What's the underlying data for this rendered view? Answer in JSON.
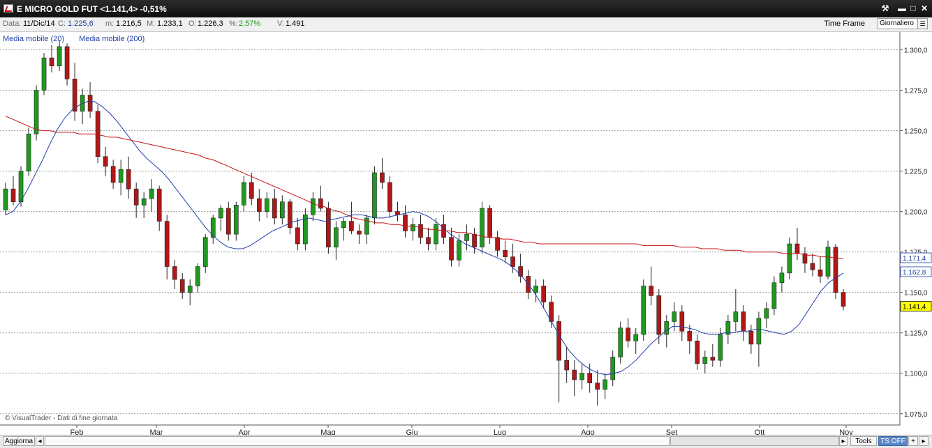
{
  "window": {
    "title": "E MICRO GOLD FUT <1.141,4> -0,51%",
    "buttons": {
      "tools": "⚒",
      "minimize": "▬",
      "maximize": "□",
      "close": "✕"
    }
  },
  "infobar": {
    "date_label": "Data:",
    "date_value": "11/Dic/14",
    "close_label": "C:",
    "close_value": "1.225,6",
    "min_label": "m:",
    "min_value": "1.216,5",
    "max_label": "M:",
    "max_value": "1.233,1",
    "open_label": "O:",
    "open_value": "1.226,3",
    "pct_label": "%:",
    "pct_value": "2,57%",
    "vol_label": "V:",
    "vol_value": "1.491",
    "timeframe_label": "Time Frame",
    "timeframe_value": "Giornaliero"
  },
  "legend": {
    "ma20": "Media mobile (20)",
    "ma200": "Media mobile (200)"
  },
  "watermark": "© VisualTrader - Dati di fine giornata",
  "bottom": {
    "refresh": "Aggiorna",
    "tools": "Tools",
    "ts_off": "TS OFF",
    "plus": "+",
    "arrow": "▸"
  },
  "colors": {
    "up": "#1f9a1f",
    "down": "#b01818",
    "ma20": "#1f3fa8",
    "ma200": "#c81414",
    "last_price_bg": "#ffff00"
  },
  "chart_data": {
    "type": "candlestick",
    "x_tick_labels": [
      "Feb",
      "Mar",
      "Apr",
      "Mag",
      "Giu",
      "Lug",
      "Ago",
      "Set",
      "Ott",
      "Nov"
    ],
    "y_tick_labels": [
      "1.300,0",
      "1.275,0",
      "1.250,0",
      "1.225,0",
      "1.200,0",
      "1.175,0",
      "1.150,0",
      "1.125,0",
      "1.100,0",
      "1.075,0"
    ],
    "y_ticks": [
      1300,
      1275,
      1250,
      1225,
      1200,
      1175,
      1150,
      1125,
      1100,
      1075
    ],
    "ylim": [
      1068,
      1311
    ],
    "price_labels": [
      {
        "text": "1.171,4",
        "value": 1171.4,
        "style": "ma200"
      },
      {
        "text": "1.162,8",
        "value": 1162.8,
        "style": "ma20"
      },
      {
        "text": "1.141,4",
        "value": 1141.4,
        "style": "last"
      }
    ],
    "series_ma20": [
      1198,
      1200,
      1206,
      1214,
      1223,
      1232,
      1242,
      1251,
      1258,
      1263,
      1266,
      1268,
      1268,
      1265,
      1261,
      1256,
      1250,
      1244,
      1238,
      1233,
      1229,
      1225,
      1220,
      1214,
      1208,
      1202,
      1196,
      1190,
      1185,
      1181,
      1178,
      1177,
      1177,
      1179,
      1182,
      1185,
      1188,
      1190,
      1192,
      1194,
      1195,
      1196,
      1195,
      1194,
      1195,
      1196,
      1197,
      1198,
      1198,
      1197,
      1196,
      1196,
      1197,
      1198,
      1199,
      1200,
      1199,
      1197,
      1194,
      1190,
      1186,
      1183,
      1180,
      1178,
      1176,
      1174,
      1172,
      1170,
      1167,
      1163,
      1158,
      1152,
      1145,
      1137,
      1129,
      1121,
      1114,
      1109,
      1105,
      1102,
      1100,
      1099,
      1100,
      1101,
      1104,
      1108,
      1113,
      1118,
      1122,
      1126,
      1129,
      1129,
      1128,
      1127,
      1125,
      1124,
      1124,
      1125,
      1125,
      1126,
      1126,
      1127,
      1127,
      1126,
      1125,
      1124,
      1126,
      1130,
      1137,
      1144,
      1151,
      1156,
      1159,
      1162
    ],
    "series_ma200": [
      1259,
      1257,
      1255,
      1253,
      1251,
      1250,
      1250,
      1249,
      1249,
      1249,
      1248,
      1248,
      1248,
      1247,
      1246,
      1246,
      1245,
      1244,
      1243,
      1242,
      1241,
      1240,
      1239,
      1238,
      1237,
      1236,
      1235,
      1233,
      1232,
      1230,
      1228,
      1226,
      1224,
      1222,
      1220,
      1218,
      1216,
      1214,
      1212,
      1210,
      1208,
      1206,
      1204,
      1203,
      1201,
      1200,
      1198,
      1196,
      1195,
      1194,
      1193,
      1193,
      1192,
      1192,
      1191,
      1191,
      1190,
      1189,
      1189,
      1188,
      1188,
      1187,
      1187,
      1186,
      1185,
      1184,
      1184,
      1183,
      1183,
      1182,
      1181,
      1181,
      1180,
      1180,
      1180,
      1180,
      1180,
      1180,
      1180,
      1180,
      1180,
      1180,
      1180,
      1180,
      1180,
      1180,
      1179,
      1179,
      1179,
      1179,
      1179,
      1178,
      1178,
      1178,
      1177,
      1177,
      1177,
      1176,
      1176,
      1176,
      1175,
      1175,
      1175,
      1175,
      1175,
      1174,
      1174,
      1174,
      1173,
      1173,
      1172,
      1172,
      1171,
      1171
    ],
    "ohlc_step": 2,
    "candles": [
      [
        1201,
        1218,
        1198,
        1214
      ],
      [
        1214,
        1222,
        1204,
        1206
      ],
      [
        1206,
        1228,
        1203,
        1225
      ],
      [
        1225,
        1252,
        1222,
        1248
      ],
      [
        1248,
        1278,
        1244,
        1275
      ],
      [
        1275,
        1298,
        1272,
        1295
      ],
      [
        1295,
        1303,
        1286,
        1290
      ],
      [
        1290,
        1306,
        1287,
        1302
      ],
      [
        1302,
        1304,
        1278,
        1282
      ],
      [
        1282,
        1292,
        1256,
        1262
      ],
      [
        1262,
        1276,
        1254,
        1272
      ],
      [
        1272,
        1280,
        1258,
        1262
      ],
      [
        1262,
        1266,
        1230,
        1234
      ],
      [
        1234,
        1240,
        1222,
        1228
      ],
      [
        1228,
        1232,
        1214,
        1218
      ],
      [
        1218,
        1232,
        1210,
        1226
      ],
      [
        1226,
        1234,
        1208,
        1214
      ],
      [
        1214,
        1218,
        1196,
        1204
      ],
      [
        1204,
        1212,
        1196,
        1208
      ],
      [
        1208,
        1220,
        1200,
        1214
      ],
      [
        1214,
        1216,
        1188,
        1194
      ],
      [
        1194,
        1198,
        1158,
        1166
      ],
      [
        1166,
        1170,
        1152,
        1158
      ],
      [
        1158,
        1162,
        1146,
        1150
      ],
      [
        1150,
        1158,
        1142,
        1154
      ],
      [
        1154,
        1168,
        1150,
        1166
      ],
      [
        1166,
        1186,
        1162,
        1184
      ],
      [
        1184,
        1198,
        1180,
        1196
      ],
      [
        1196,
        1204,
        1188,
        1202
      ],
      [
        1202,
        1206,
        1182,
        1186
      ],
      [
        1186,
        1206,
        1182,
        1204
      ],
      [
        1204,
        1222,
        1200,
        1218
      ],
      [
        1218,
        1224,
        1204,
        1208
      ],
      [
        1208,
        1214,
        1194,
        1200
      ],
      [
        1200,
        1212,
        1196,
        1208
      ],
      [
        1208,
        1214,
        1192,
        1196
      ],
      [
        1196,
        1210,
        1192,
        1206
      ],
      [
        1206,
        1208,
        1186,
        1190
      ],
      [
        1190,
        1196,
        1176,
        1180
      ],
      [
        1180,
        1202,
        1176,
        1198
      ],
      [
        1198,
        1212,
        1194,
        1208
      ],
      [
        1208,
        1216,
        1200,
        1202
      ],
      [
        1202,
        1206,
        1174,
        1178
      ],
      [
        1178,
        1194,
        1170,
        1190
      ],
      [
        1190,
        1196,
        1182,
        1194
      ],
      [
        1194,
        1206,
        1186,
        1188
      ],
      [
        1188,
        1192,
        1180,
        1186
      ],
      [
        1186,
        1198,
        1180,
        1196
      ],
      [
        1196,
        1228,
        1192,
        1224
      ],
      [
        1224,
        1233,
        1214,
        1218
      ],
      [
        1218,
        1222,
        1196,
        1200
      ],
      [
        1200,
        1206,
        1194,
        1198
      ],
      [
        1198,
        1204,
        1184,
        1188
      ],
      [
        1188,
        1196,
        1182,
        1192
      ],
      [
        1192,
        1198,
        1180,
        1184
      ],
      [
        1184,
        1190,
        1176,
        1180
      ],
      [
        1180,
        1196,
        1176,
        1192
      ],
      [
        1192,
        1198,
        1180,
        1184
      ],
      [
        1184,
        1190,
        1166,
        1170
      ],
      [
        1170,
        1186,
        1166,
        1182
      ],
      [
        1182,
        1192,
        1176,
        1186
      ],
      [
        1186,
        1190,
        1174,
        1178
      ],
      [
        1178,
        1206,
        1174,
        1202
      ],
      [
        1202,
        1204,
        1180,
        1184
      ],
      [
        1184,
        1188,
        1172,
        1176
      ],
      [
        1176,
        1182,
        1168,
        1172
      ],
      [
        1172,
        1180,
        1162,
        1166
      ],
      [
        1166,
        1174,
        1156,
        1160
      ],
      [
        1160,
        1164,
        1146,
        1150
      ],
      [
        1150,
        1158,
        1144,
        1154
      ],
      [
        1154,
        1158,
        1140,
        1144
      ],
      [
        1144,
        1148,
        1128,
        1132
      ],
      [
        1132,
        1136,
        1082,
        1108
      ],
      [
        1108,
        1116,
        1094,
        1102
      ],
      [
        1102,
        1108,
        1086,
        1096
      ],
      [
        1096,
        1106,
        1090,
        1100
      ],
      [
        1100,
        1106,
        1088,
        1094
      ],
      [
        1094,
        1102,
        1080,
        1090
      ],
      [
        1090,
        1100,
        1084,
        1096
      ],
      [
        1096,
        1114,
        1092,
        1110
      ],
      [
        1110,
        1132,
        1106,
        1128
      ],
      [
        1128,
        1134,
        1116,
        1120
      ],
      [
        1120,
        1128,
        1112,
        1124
      ],
      [
        1124,
        1158,
        1120,
        1154
      ],
      [
        1154,
        1166,
        1142,
        1148
      ],
      [
        1148,
        1152,
        1118,
        1124
      ],
      [
        1124,
        1136,
        1116,
        1132
      ],
      [
        1132,
        1144,
        1126,
        1138
      ],
      [
        1138,
        1142,
        1120,
        1126
      ],
      [
        1126,
        1130,
        1112,
        1120
      ],
      [
        1120,
        1124,
        1102,
        1106
      ],
      [
        1106,
        1114,
        1100,
        1110
      ],
      [
        1110,
        1118,
        1104,
        1108
      ],
      [
        1108,
        1128,
        1104,
        1124
      ],
      [
        1124,
        1136,
        1118,
        1132
      ],
      [
        1132,
        1152,
        1126,
        1138
      ],
      [
        1138,
        1142,
        1120,
        1126
      ],
      [
        1126,
        1130,
        1112,
        1118
      ],
      [
        1118,
        1138,
        1104,
        1134
      ],
      [
        1134,
        1144,
        1128,
        1140
      ],
      [
        1140,
        1160,
        1136,
        1156
      ],
      [
        1156,
        1166,
        1150,
        1162
      ],
      [
        1162,
        1184,
        1158,
        1180
      ],
      [
        1180,
        1190,
        1170,
        1174
      ],
      [
        1174,
        1178,
        1162,
        1168
      ],
      [
        1168,
        1174,
        1160,
        1164
      ],
      [
        1164,
        1172,
        1156,
        1160
      ],
      [
        1160,
        1182,
        1158,
        1178
      ],
      [
        1178,
        1180,
        1146,
        1150
      ],
      [
        1150,
        1152,
        1139,
        1141.4
      ]
    ]
  }
}
